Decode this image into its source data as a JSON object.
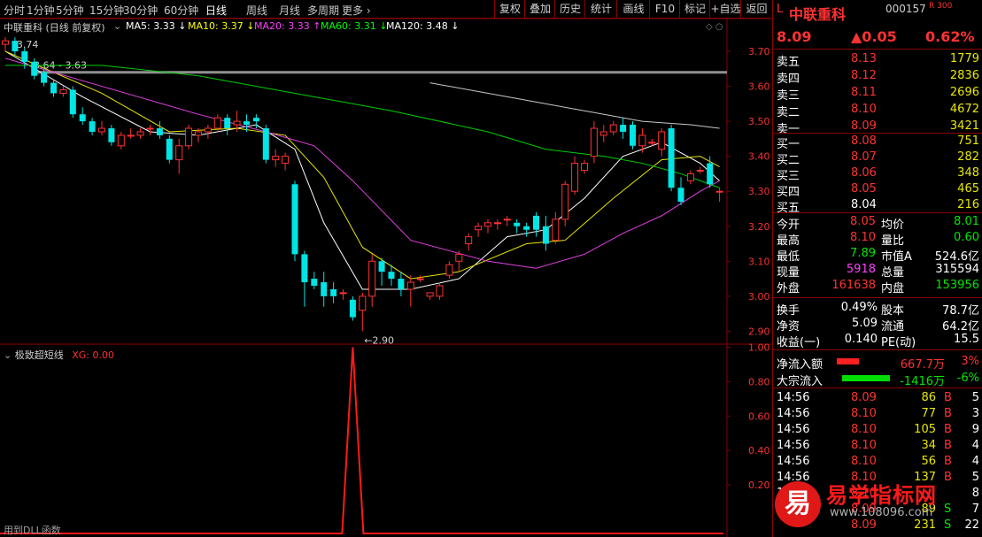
{
  "toolbar": {
    "timeframes": [
      "分时",
      "1分钟",
      "5分钟",
      "15分钟",
      "30分钟",
      "60分钟",
      "日线",
      "周线",
      "月线",
      "多周期",
      "更多"
    ],
    "active_timeframe": "日线",
    "buttons": [
      "复权",
      "叠加",
      "历史",
      "统计",
      "画线",
      "F10",
      "标记",
      "+自选",
      "返回"
    ]
  },
  "main_chart": {
    "title": "中联重科 (日线 前复权)",
    "ma_labels": [
      {
        "text": "MA5: 3.33",
        "color": "#ffffff"
      },
      {
        "text": "MA10: 3.37",
        "color": "#ffff00"
      },
      {
        "text": "MA20: 3.33",
        "color": "#ff40ff"
      },
      {
        "text": "MA60: 3.31",
        "color": "#00ff00"
      },
      {
        "text": "MA120: 3.48",
        "color": "#ffffff"
      }
    ],
    "ma_arrows": [
      "↓",
      "↓",
      "↑",
      "↓",
      "↓"
    ],
    "annotations": {
      "high": "3.74",
      "low": "2.90",
      "range": "3.64 - 3.63"
    },
    "price_axis": [
      "3.70",
      "3.60",
      "3.50",
      "3.40",
      "3.30",
      "3.20",
      "3.10",
      "3.00",
      "2.90"
    ],
    "candles": [
      [
        3.72,
        3.74,
        3.7,
        3.73
      ],
      [
        3.73,
        3.74,
        3.69,
        3.7
      ],
      [
        3.7,
        3.71,
        3.65,
        3.67
      ],
      [
        3.67,
        3.68,
        3.62,
        3.63
      ],
      [
        3.64,
        3.65,
        3.6,
        3.61
      ],
      [
        3.61,
        3.62,
        3.57,
        3.58
      ],
      [
        3.58,
        3.6,
        3.57,
        3.59
      ],
      [
        3.59,
        3.6,
        3.51,
        3.52
      ],
      [
        3.52,
        3.54,
        3.49,
        3.5
      ],
      [
        3.5,
        3.51,
        3.46,
        3.47
      ],
      [
        3.47,
        3.5,
        3.46,
        3.48
      ],
      [
        3.48,
        3.49,
        3.43,
        3.44
      ],
      [
        3.43,
        3.47,
        3.42,
        3.46
      ],
      [
        3.46,
        3.48,
        3.45,
        3.46
      ],
      [
        3.46,
        3.48,
        3.45,
        3.47
      ],
      [
        3.48,
        3.49,
        3.46,
        3.48
      ],
      [
        3.48,
        3.5,
        3.45,
        3.46
      ],
      [
        3.45,
        3.46,
        3.38,
        3.39
      ],
      [
        3.39,
        3.45,
        3.35,
        3.43
      ],
      [
        3.43,
        3.49,
        3.42,
        3.48
      ],
      [
        3.46,
        3.48,
        3.44,
        3.47
      ],
      [
        3.47,
        3.49,
        3.45,
        3.48
      ],
      [
        3.48,
        3.52,
        3.47,
        3.51
      ],
      [
        3.51,
        3.52,
        3.46,
        3.48
      ],
      [
        3.49,
        3.53,
        3.47,
        3.5
      ],
      [
        3.5,
        3.52,
        3.47,
        3.49
      ],
      [
        3.51,
        3.52,
        3.48,
        3.5
      ],
      [
        3.48,
        3.49,
        3.38,
        3.39
      ],
      [
        3.39,
        3.42,
        3.37,
        3.4
      ],
      [
        3.38,
        3.41,
        3.36,
        3.4
      ],
      [
        3.32,
        3.33,
        3.1,
        3.12
      ],
      [
        3.12,
        3.13,
        2.97,
        3.04
      ],
      [
        3.05,
        3.07,
        3.02,
        3.03
      ],
      [
        3.04,
        3.07,
        2.97,
        3.0
      ],
      [
        3.02,
        3.04,
        2.98,
        3.0
      ],
      [
        3.01,
        3.02,
        2.99,
        3.01
      ],
      [
        2.99,
        3.0,
        2.93,
        2.94
      ],
      [
        2.96,
        3.01,
        2.9,
        3.0
      ],
      [
        3.0,
        3.12,
        2.97,
        3.1
      ],
      [
        3.1,
        3.11,
        3.03,
        3.07
      ],
      [
        3.07,
        3.09,
        3.03,
        3.05
      ],
      [
        3.05,
        3.07,
        3.0,
        3.02
      ],
      [
        3.02,
        3.06,
        2.97,
        3.04
      ],
      [
        3.05,
        3.06,
        3.04,
        3.05
      ],
      [
        3.0,
        3.01,
        2.99,
        3.01
      ],
      [
        3.0,
        3.04,
        2.99,
        3.03
      ],
      [
        3.06,
        3.1,
        3.05,
        3.09
      ],
      [
        3.1,
        3.13,
        3.07,
        3.12
      ],
      [
        3.15,
        3.18,
        3.13,
        3.17
      ],
      [
        3.19,
        3.21,
        3.17,
        3.2
      ],
      [
        3.2,
        3.22,
        3.18,
        3.21
      ],
      [
        3.21,
        3.22,
        3.19,
        3.21
      ],
      [
        3.22,
        3.23,
        3.2,
        3.22
      ],
      [
        3.21,
        3.22,
        3.18,
        3.2
      ],
      [
        3.2,
        3.21,
        3.17,
        3.19
      ],
      [
        3.23,
        3.24,
        3.17,
        3.19
      ],
      [
        3.2,
        3.23,
        3.13,
        3.15
      ],
      [
        3.16,
        3.24,
        3.15,
        3.22
      ],
      [
        3.22,
        3.33,
        3.2,
        3.32
      ],
      [
        3.3,
        3.4,
        3.29,
        3.38
      ],
      [
        3.36,
        3.39,
        3.35,
        3.38
      ],
      [
        3.4,
        3.5,
        3.38,
        3.48
      ],
      [
        3.46,
        3.49,
        3.44,
        3.47
      ],
      [
        3.47,
        3.5,
        3.46,
        3.49
      ],
      [
        3.49,
        3.51,
        3.45,
        3.47
      ],
      [
        3.49,
        3.5,
        3.42,
        3.43
      ],
      [
        3.43,
        3.48,
        3.41,
        3.46
      ],
      [
        3.44,
        3.45,
        3.43,
        3.44
      ],
      [
        3.42,
        3.48,
        3.4,
        3.47
      ],
      [
        3.48,
        3.49,
        3.3,
        3.31
      ],
      [
        3.31,
        3.34,
        3.26,
        3.27
      ],
      [
        3.33,
        3.36,
        3.32,
        3.35
      ],
      [
        3.36,
        3.37,
        3.35,
        3.36
      ],
      [
        3.38,
        3.4,
        3.31,
        3.32
      ],
      [
        3.3,
        3.31,
        3.27,
        3.3
      ]
    ],
    "ma_points": {
      "ma5": [
        [
          0,
          3.7
        ],
        [
          8,
          3.57
        ],
        [
          15,
          3.47
        ],
        [
          20,
          3.46
        ],
        [
          26,
          3.49
        ],
        [
          30,
          3.42
        ],
        [
          33,
          3.21
        ],
        [
          37,
          3.02
        ],
        [
          42,
          3.02
        ],
        [
          47,
          3.05
        ],
        [
          52,
          3.17
        ],
        [
          56,
          3.19
        ],
        [
          60,
          3.28
        ],
        [
          64,
          3.4
        ],
        [
          68,
          3.44
        ],
        [
          72,
          3.38
        ],
        [
          74,
          3.33
        ]
      ],
      "ma10": [
        [
          0,
          3.7
        ],
        [
          10,
          3.58
        ],
        [
          17,
          3.47
        ],
        [
          24,
          3.48
        ],
        [
          29,
          3.46
        ],
        [
          33,
          3.34
        ],
        [
          37,
          3.14
        ],
        [
          42,
          3.05
        ],
        [
          47,
          3.07
        ],
        [
          54,
          3.15
        ],
        [
          58,
          3.16
        ],
        [
          63,
          3.28
        ],
        [
          68,
          3.39
        ],
        [
          72,
          3.4
        ],
        [
          74,
          3.37
        ]
      ],
      "ma20": [
        [
          0,
          3.68
        ],
        [
          10,
          3.6
        ],
        [
          20,
          3.52
        ],
        [
          27,
          3.47
        ],
        [
          32,
          3.43
        ],
        [
          36,
          3.33
        ],
        [
          42,
          3.16
        ],
        [
          50,
          3.1
        ],
        [
          55,
          3.08
        ],
        [
          60,
          3.12
        ],
        [
          64,
          3.18
        ],
        [
          68,
          3.23
        ],
        [
          72,
          3.3
        ],
        [
          74,
          3.33
        ]
      ],
      "ma60": [
        [
          0,
          3.66
        ],
        [
          10,
          3.66
        ],
        [
          20,
          3.63
        ],
        [
          30,
          3.58
        ],
        [
          40,
          3.53
        ],
        [
          50,
          3.47
        ],
        [
          56,
          3.42
        ],
        [
          62,
          3.4
        ],
        [
          66,
          3.38
        ],
        [
          70,
          3.35
        ],
        [
          74,
          3.31
        ]
      ],
      "ma120": [
        [
          44,
          3.61
        ],
        [
          52,
          3.57
        ],
        [
          60,
          3.53
        ],
        [
          66,
          3.5
        ],
        [
          71,
          3.49
        ],
        [
          74,
          3.48
        ]
      ]
    }
  },
  "sub_chart": {
    "title": "极致超短线",
    "xg_label": "XG: 0.00",
    "axis": [
      "1.00",
      "0.80",
      "0.60",
      "0.40",
      "0.20"
    ],
    "spike_at_candle": 36,
    "footer": "用到DLL函数"
  },
  "quote": {
    "prefix": "L",
    "name": "中联重科",
    "code": "000157",
    "badge": "R 300",
    "price": "8.09",
    "change": "▲0.05",
    "pct": "0.62%",
    "asks": [
      {
        "label": "卖五",
        "price": "8.13",
        "vol": "1779"
      },
      {
        "label": "卖四",
        "price": "8.12",
        "vol": "2836"
      },
      {
        "label": "卖三",
        "price": "8.11",
        "vol": "2696"
      },
      {
        "label": "卖二",
        "price": "8.10",
        "vol": "4672"
      },
      {
        "label": "卖一",
        "price": "8.09",
        "vol": "3421"
      }
    ],
    "bids": [
      {
        "label": "买一",
        "price": "8.08",
        "vol": "751"
      },
      {
        "label": "买二",
        "price": "8.07",
        "vol": "282"
      },
      {
        "label": "买三",
        "price": "8.06",
        "vol": "348"
      },
      {
        "label": "买四",
        "price": "8.05",
        "vol": "465"
      },
      {
        "label": "买五",
        "price": "8.04",
        "vol": "216"
      }
    ],
    "stats": [
      {
        "l1": "今开",
        "v1": "8.05",
        "c1": "red",
        "l2": "均价",
        "v2": "8.01",
        "c2": "green"
      },
      {
        "l1": "最高",
        "v1": "8.10",
        "c1": "red",
        "l2": "量比",
        "v2": "0.60",
        "c2": "green"
      },
      {
        "l1": "最低",
        "v1": "7.89",
        "c1": "green",
        "l2": "市值A",
        "v2": "524.6亿",
        "c2": "white"
      },
      {
        "l1": "现量",
        "v1": "5918",
        "c1": "mag",
        "l2": "总量",
        "v2": "315594",
        "c2": "white"
      },
      {
        "l1": "外盘",
        "v1": "161638",
        "c1": "red",
        "l2": "内盘",
        "v2": "153956",
        "c2": "green"
      }
    ],
    "stats2": [
      {
        "l1": "换手",
        "v1": "0.49%",
        "l2": "股本",
        "v2": "78.7亿"
      },
      {
        "l1": "净资",
        "v1": "5.09",
        "l2": "流通",
        "v2": "64.2亿"
      },
      {
        "l1": "收益(一)",
        "v1": "0.140",
        "l2": "PE(动)",
        "v2": "15.5"
      }
    ],
    "flows": [
      {
        "label": "净流入额",
        "bar": 0.35,
        "color": "#ff2020",
        "value": "667.7万",
        "vcolor": "red",
        "pct": "3%",
        "pcolor": "red"
      },
      {
        "label": "大宗流入",
        "bar": 0.75,
        "color": "#00dd00",
        "value": "-1416万",
        "vcolor": "green",
        "pct": "-6%",
        "pcolor": "green"
      }
    ],
    "ticks": [
      {
        "t": "14:56",
        "p": "8.09",
        "v": "86",
        "bs": "B",
        "n": "5"
      },
      {
        "t": "14:56",
        "p": "8.10",
        "v": "77",
        "bs": "B",
        "n": "3"
      },
      {
        "t": "14:56",
        "p": "8.10",
        "v": "105",
        "bs": "B",
        "n": "9"
      },
      {
        "t": "14:56",
        "p": "8.10",
        "v": "34",
        "bs": "B",
        "n": "4"
      },
      {
        "t": "14:56",
        "p": "8.10",
        "v": "56",
        "bs": "B",
        "n": "4"
      },
      {
        "t": "14:56",
        "p": "8.10",
        "v": "137",
        "bs": "B",
        "n": "5"
      },
      {
        "t": "14:57",
        "p": "8.10",
        "v": "",
        "bs": "",
        "n": "8"
      },
      {
        "t": "",
        "p": "8.09",
        "v": "89",
        "bs": "S",
        "n": "7"
      },
      {
        "t": "",
        "p": "8.09",
        "v": "231",
        "bs": "S",
        "n": "22"
      }
    ],
    "watermark": {
      "title": "易学指标网",
      "url": "www.108096.com",
      "logo": "易"
    }
  }
}
